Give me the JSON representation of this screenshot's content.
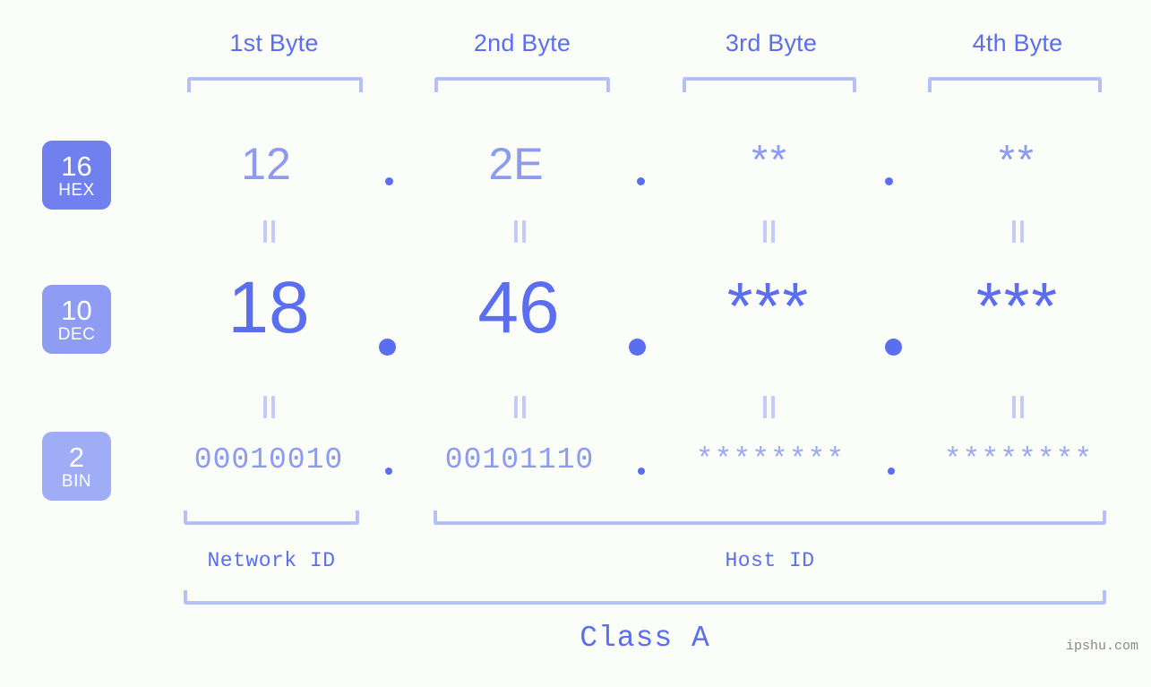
{
  "background_color": "#fbfdf8",
  "accent_color": "#5b6ef0",
  "accent_light_color": "#8c9bf0",
  "bracket_color": "#b5c0f7",
  "byte_headers": [
    {
      "label": "1st Byte"
    },
    {
      "label": "2nd Byte"
    },
    {
      "label": "3rd Byte"
    },
    {
      "label": "4th Byte"
    }
  ],
  "radix_rows": [
    {
      "badge_number": "16",
      "badge_name": "HEX",
      "badge_color": "#7081ef",
      "values": [
        "12",
        "2E",
        "**",
        "**"
      ],
      "known": [
        true,
        true,
        false,
        false
      ]
    },
    {
      "badge_number": "10",
      "badge_name": "DEC",
      "badge_color": "#8e9cf3",
      "values": [
        "18",
        "46",
        "***",
        "***"
      ],
      "known": [
        true,
        true,
        false,
        false
      ]
    },
    {
      "badge_number": "2",
      "badge_name": "BIN",
      "badge_color": "#9fadf6",
      "values": [
        "00010010",
        "00101110",
        "********",
        "********"
      ],
      "known": [
        true,
        true,
        false,
        false
      ]
    }
  ],
  "separator": ".",
  "equality_symbol": "||",
  "id_sections": [
    {
      "label": "Network ID"
    },
    {
      "label": "Host ID"
    }
  ],
  "class_label": "Class A",
  "watermark": "ipshu.com"
}
